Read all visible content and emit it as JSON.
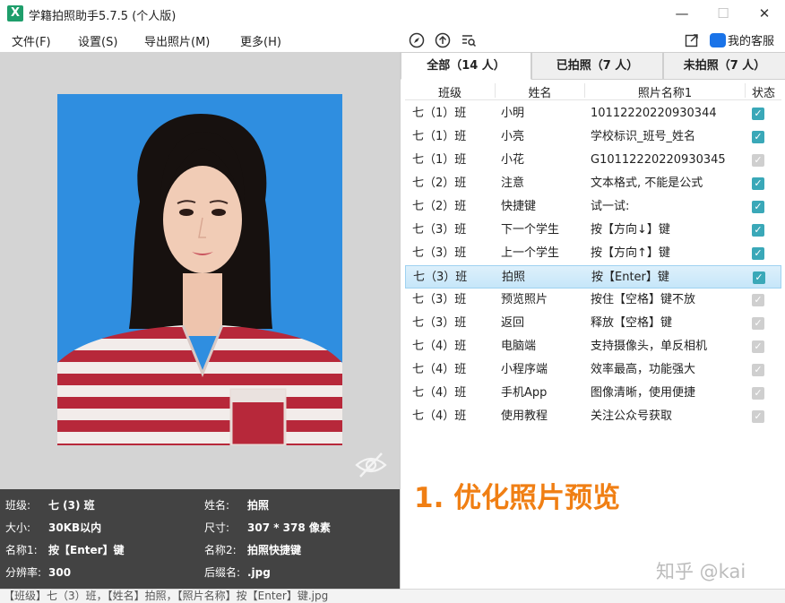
{
  "window": {
    "title": "学籍拍照助手5.7.5 (个人版)",
    "logo": "X",
    "minimize": "—",
    "maximize": "☐",
    "close": "✕"
  },
  "menu": {
    "items": [
      "文件(F)",
      "设置(S)",
      "导出照片(M)",
      "更多(H)"
    ],
    "service": "我的客服"
  },
  "tabs": [
    {
      "label": "全部（14 人）"
    },
    {
      "label": "已拍照（7 人）"
    },
    {
      "label": "未拍照（7 人）"
    }
  ],
  "table": {
    "columns": [
      "班级",
      "姓名",
      "照片名称1",
      "状态"
    ],
    "rows": [
      {
        "class": "七（1）班",
        "name": "小明",
        "photo_name": "10112220220930344",
        "checked": true
      },
      {
        "class": "七（1）班",
        "name": "小亮",
        "photo_name": "学校标识_班号_姓名",
        "checked": true
      },
      {
        "class": "七（1）班",
        "name": "小花",
        "photo_name": "G10112220220930345",
        "checked": false
      },
      {
        "class": "七（2）班",
        "name": "注意",
        "photo_name": "文本格式, 不能是公式",
        "checked": true
      },
      {
        "class": "七（2）班",
        "name": "快捷键",
        "photo_name": "试一试:",
        "checked": true
      },
      {
        "class": "七（3）班",
        "name": "下一个学生",
        "photo_name": "按【方向↓】键",
        "checked": true
      },
      {
        "class": "七（3）班",
        "name": "上一个学生",
        "photo_name": "按【方向↑】键",
        "checked": true
      },
      {
        "class": "七（3）班",
        "name": "拍照",
        "photo_name": "按【Enter】键",
        "checked": true,
        "selected": true
      },
      {
        "class": "七（3）班",
        "name": "预览照片",
        "photo_name": "按住【空格】键不放",
        "checked": false
      },
      {
        "class": "七（3）班",
        "name": "返回",
        "photo_name": "释放【空格】键",
        "checked": false
      },
      {
        "class": "七（4）班",
        "name": "电脑端",
        "photo_name": "支持摄像头，单反相机",
        "checked": false
      },
      {
        "class": "七（4）班",
        "name": "小程序端",
        "photo_name": "效率最高，功能强大",
        "checked": false
      },
      {
        "class": "七（4）班",
        "name": "手机App",
        "photo_name": "图像清晰，使用便捷",
        "checked": false
      },
      {
        "class": "七（4）班",
        "name": "使用教程",
        "photo_name": "关注公众号获取",
        "checked": false
      }
    ]
  },
  "info": {
    "class_label": "班级:",
    "class_value": "七 (3) 班",
    "name_label": "姓名:",
    "name_value": "拍照",
    "size_label": "大小:",
    "size_value": "30KB以内",
    "dim_label": "尺寸:",
    "dim_value": "307 * 378 像素",
    "name1_label": "名称1:",
    "name1_value": "按【Enter】键",
    "name2_label": "名称2:",
    "name2_value": "拍照快捷键",
    "res_label": "分辨率:",
    "res_value": "300",
    "ext_label": "后缀名:",
    "ext_value": ".jpg"
  },
  "statusbar": "【班级】七（3）班，【姓名】拍照，【照片名称】按【Enter】键.jpg",
  "overlay_text": "1. 优化照片预览",
  "watermark": "知乎 @kai",
  "colors": {
    "accent_orange": "#f07f14",
    "photo_bg": "#2f8ee0",
    "check_on": "#3aa8b8",
    "stripe_red": "#b7283a"
  }
}
